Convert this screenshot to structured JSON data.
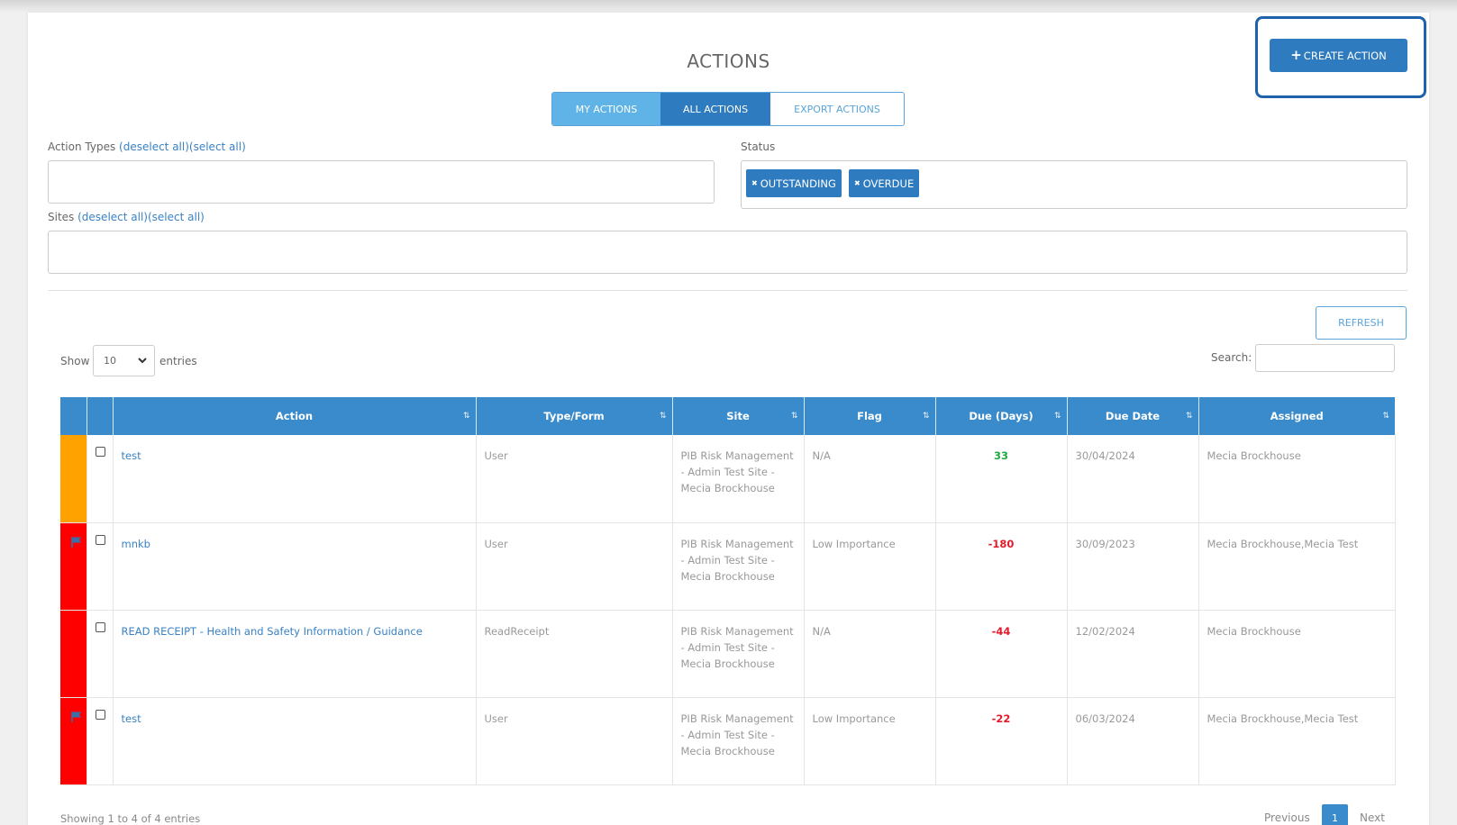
{
  "page": {
    "title": "ACTIONS"
  },
  "create_action": {
    "label": "CREATE ACTION",
    "icon": "plus-icon"
  },
  "tabs": [
    {
      "label": "MY ACTIONS"
    },
    {
      "label": "ALL ACTIONS"
    },
    {
      "label": "EXPORT ACTIONS"
    }
  ],
  "filters": {
    "action_types": {
      "label": "Action Types",
      "deselect": "(deselect all)",
      "select": "(select all)"
    },
    "status": {
      "label": "Status",
      "chips": [
        {
          "label": "OUTSTANDING"
        },
        {
          "label": "OVERDUE"
        }
      ]
    },
    "sites": {
      "label": "Sites",
      "deselect": "(deselect all)",
      "select": "(select all)"
    }
  },
  "refresh": {
    "label": "REFRESH"
  },
  "length_menu": {
    "show": "Show",
    "value": "10",
    "entries": "entries"
  },
  "search": {
    "label": "Search:"
  },
  "table": {
    "columns": [
      "Action",
      "Type/Form",
      "Site",
      "Flag",
      "Due (Days)",
      "Due Date",
      "Assigned"
    ],
    "rows": [
      {
        "color": "#ffa200",
        "flag_icon": false,
        "action": "test",
        "type": "User",
        "site": "PIB Risk Management - Admin Test Site - Mecia Brockhouse",
        "flag": "N/A",
        "due_days": "33",
        "due_positive": true,
        "due_date": "30/04/2024",
        "assigned": "Mecia Brockhouse"
      },
      {
        "color": "#ff0000",
        "flag_icon": true,
        "action": "mnkb",
        "type": "User",
        "site": "PIB Risk Management - Admin Test Site - Mecia Brockhouse",
        "flag": "Low Importance",
        "due_days": "-180",
        "due_positive": false,
        "due_date": "30/09/2023",
        "assigned": "Mecia Brockhouse,Mecia Test"
      },
      {
        "color": "#ff0000",
        "flag_icon": false,
        "action": "READ RECEIPT - Health and Safety Information / Guidance",
        "type": "ReadReceipt",
        "site": "PIB Risk Management - Admin Test Site - Mecia Brockhouse",
        "flag": "N/A",
        "due_days": "-44",
        "due_positive": false,
        "due_date": "12/02/2024",
        "assigned": "Mecia Brockhouse"
      },
      {
        "color": "#ff0000",
        "flag_icon": true,
        "action": "test",
        "type": "User",
        "site": "PIB Risk Management - Admin Test Site - Mecia Brockhouse",
        "flag": "Low Importance",
        "due_days": "-22",
        "due_positive": false,
        "due_date": "06/03/2024",
        "assigned": "Mecia Brockhouse,Mecia Test"
      }
    ]
  },
  "footer": {
    "info": "Showing 1 to 4 of 4 entries"
  },
  "pagination": {
    "previous": "Previous",
    "current": "1",
    "next": "Next"
  }
}
